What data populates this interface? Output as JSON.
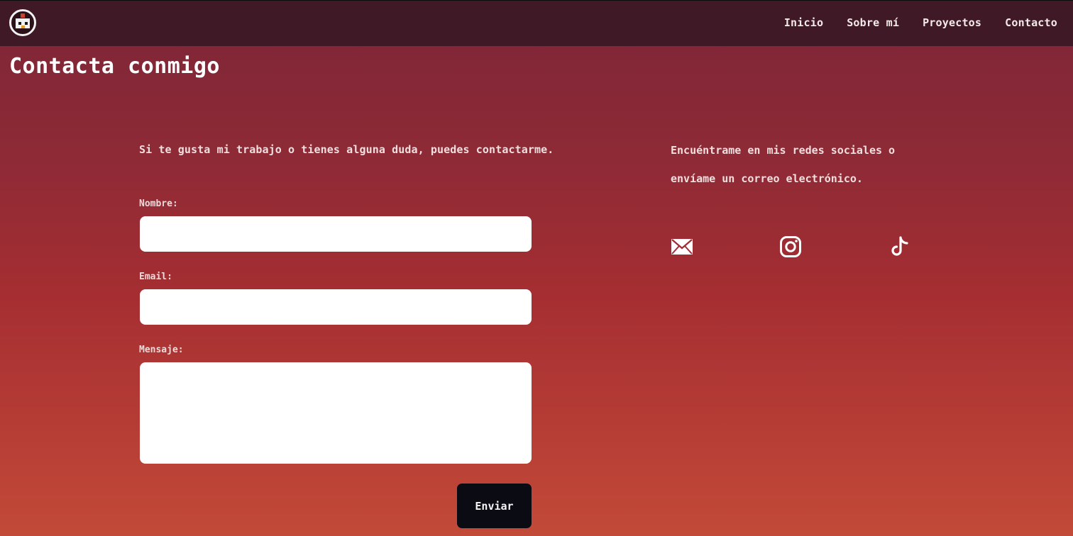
{
  "nav": {
    "logo_icon": "pixel-bird-logo-icon",
    "links": [
      "Inicio",
      "Sobre mí",
      "Proyectos",
      "Contacto"
    ]
  },
  "page": {
    "title": "Contacta conmigo"
  },
  "form": {
    "intro": "Si te gusta mi trabajo o tienes alguna duda, puedes contactarme.",
    "name_label": "Nombre:",
    "name_value": "",
    "email_label": "Email:",
    "email_value": "",
    "message_label": "Mensaje:",
    "message_value": "",
    "submit_label": "Enviar"
  },
  "social": {
    "text": "Encuéntrame en mis redes sociales o envíame un correo electrónico.",
    "icons": [
      "mail-icon",
      "instagram-icon",
      "tiktok-icon"
    ]
  },
  "colors": {
    "navbar": "#401926",
    "gradient_top": "#7d2538",
    "gradient_bottom": "#c24a38",
    "button": "#0b0b14",
    "field": "#ffffff"
  }
}
